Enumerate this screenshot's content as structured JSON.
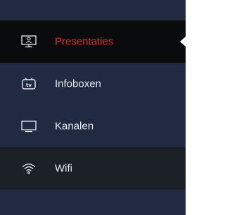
{
  "nav": {
    "items": [
      {
        "label": "Presentaties",
        "icon": "presentation-screen-icon",
        "active": true
      },
      {
        "label": "Infoboxen",
        "icon": "tv-icon",
        "active": false
      },
      {
        "label": "Kanalen",
        "icon": "monitor-icon",
        "active": false
      },
      {
        "label": "Wifi",
        "icon": "wifi-icon",
        "active": false
      }
    ]
  },
  "colors": {
    "sidebar_bg": "#212a40",
    "active_bg": "#0a0b0d",
    "hover_bg": "#1c2027",
    "active_text": "#e8252f",
    "text": "#e8eaf0"
  }
}
